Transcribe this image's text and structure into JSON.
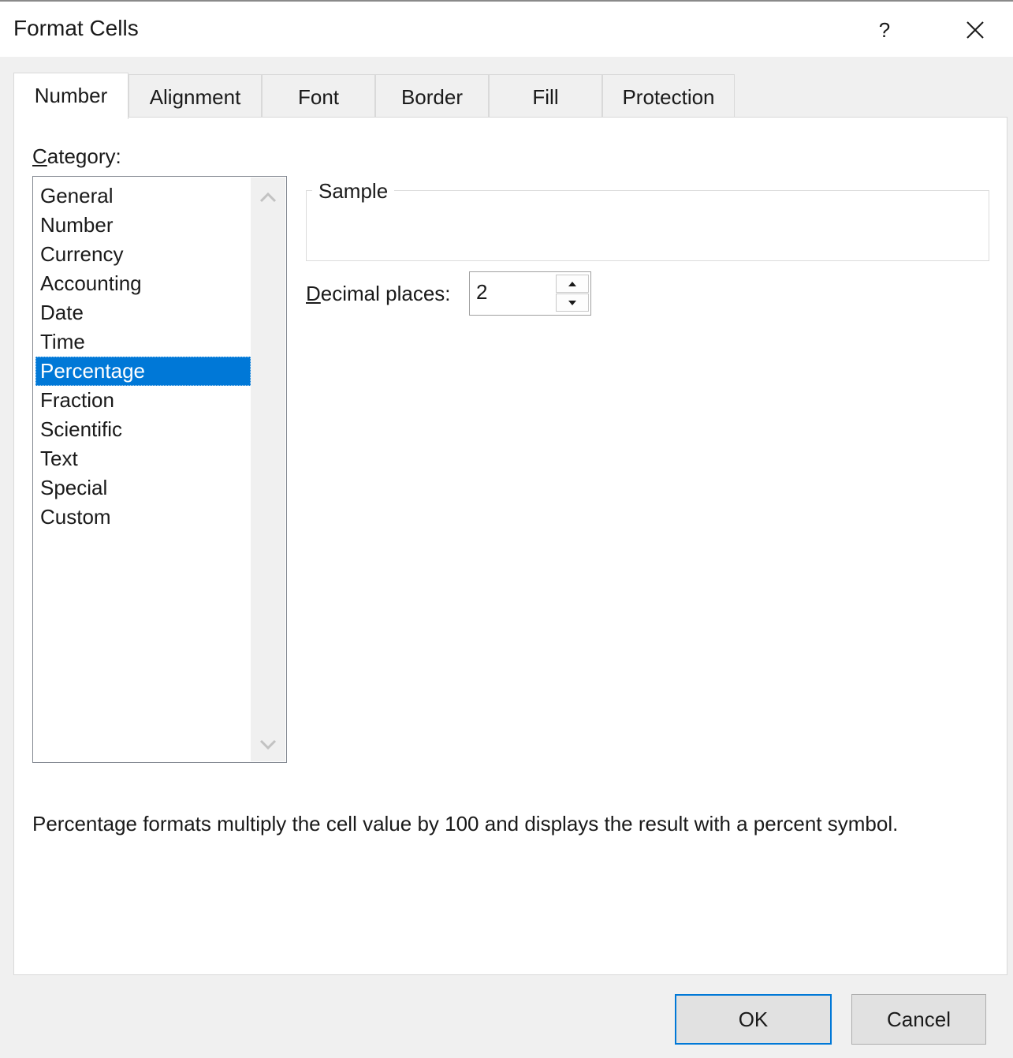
{
  "window": {
    "title": "Format Cells",
    "help_label": "?",
    "close_icon": "close-icon"
  },
  "tabs": [
    {
      "label": "Number",
      "active": true
    },
    {
      "label": "Alignment",
      "active": false
    },
    {
      "label": "Font",
      "active": false
    },
    {
      "label": "Border",
      "active": false
    },
    {
      "label": "Fill",
      "active": false
    },
    {
      "label": "Protection",
      "active": false
    }
  ],
  "category": {
    "label_first": "C",
    "label_rest": "ategory:",
    "items": [
      "General",
      "Number",
      "Currency",
      "Accounting",
      "Date",
      "Time",
      "Percentage",
      "Fraction",
      "Scientific",
      "Text",
      "Special",
      "Custom"
    ],
    "selected": "Percentage"
  },
  "sample": {
    "label": "Sample",
    "value": ""
  },
  "decimal_places": {
    "label_first": "D",
    "label_rest": "ecimal places:",
    "value": "2"
  },
  "description": "Percentage formats multiply the cell value by 100 and displays the result with a percent symbol.",
  "buttons": {
    "ok": "OK",
    "cancel": "Cancel"
  },
  "colors": {
    "selection": "#0078d7",
    "dialog_bg": "#f0f0f0",
    "panel_bg": "#ffffff"
  }
}
